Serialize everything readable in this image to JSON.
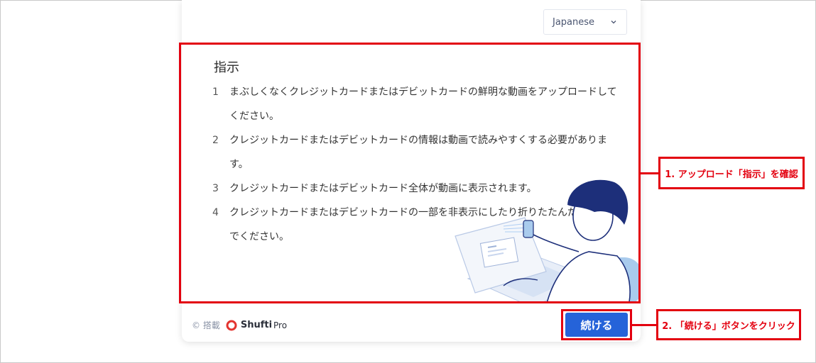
{
  "language_select": {
    "value": "Japanese"
  },
  "instructions": {
    "title": "指示",
    "items": [
      {
        "num": "1",
        "text": "まぶしくなくクレジットカードまたはデビットカードの鮮明な動画をアップロードしてください。"
      },
      {
        "num": "2",
        "text": "クレジットカードまたはデビットカードの情報は動画で読みやすくする必要があります。"
      },
      {
        "num": "3",
        "text": "クレジットカードまたはデビットカード全体が動画に表示されます。"
      },
      {
        "num": "4",
        "text": "クレジットカードまたはデビットカードの一部を非表示にしたり折りたたんだりしないでください。"
      }
    ]
  },
  "footer": {
    "powered_by": "© 搭載",
    "brand_name": "Shufti",
    "brand_suffix": "Pro"
  },
  "continue_button": {
    "label": "続ける"
  },
  "annotations": {
    "callout_1": "1. アップロード「指示」を確認",
    "callout_2": "2. 「続ける」ボタンをクリック"
  },
  "colors": {
    "highlight_red": "#e3000f",
    "primary_blue": "#2563d9"
  }
}
